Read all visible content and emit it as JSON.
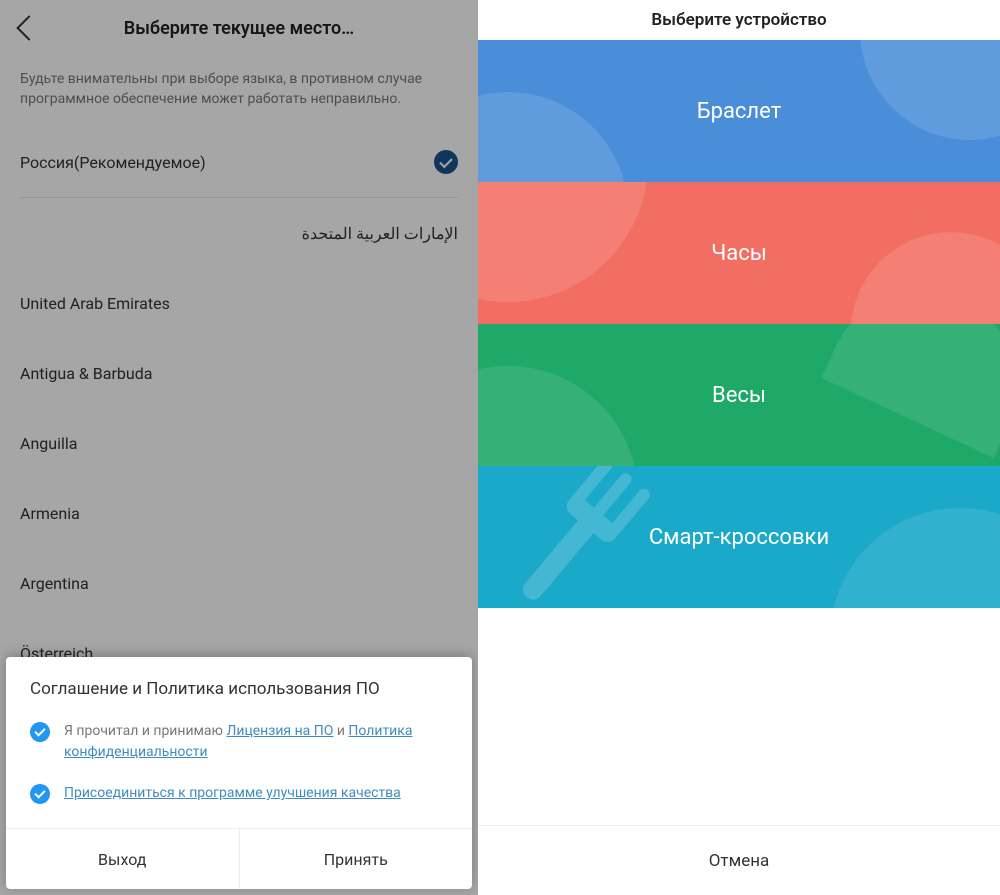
{
  "left": {
    "title": "Выберите текущее место…",
    "hint": "Будьте внимательны при выборе языка, в противном случае программное обеспечение может работать неправильно.",
    "countries": [
      {
        "label": "Россия(Рекомендуемое)",
        "selected": true
      },
      {
        "label": "الإمارات العربية المتحدة",
        "rtl": true
      },
      {
        "label": "United Arab Emirates"
      },
      {
        "label": "Antigua & Barbuda"
      },
      {
        "label": "Anguilla"
      },
      {
        "label": "Armenia"
      },
      {
        "label": "Argentina"
      },
      {
        "label": "Österreich"
      }
    ],
    "dialog": {
      "title": "Соглашение и Политика использования ПО",
      "row1_prefix": "Я прочитал и принимаю ",
      "row1_link1": "Лицензия на ПО",
      "row1_mid": " и ",
      "row1_link2": "Политика конфиденциальности",
      "row2_link": "Присоединиться к программе улучшения качества",
      "btn_exit": "Выход",
      "btn_accept": "Принять"
    }
  },
  "right": {
    "title": "Выберите устройство",
    "devices": [
      {
        "label": "Браслет",
        "color": "blue"
      },
      {
        "label": "Часы",
        "color": "red"
      },
      {
        "label": "Весы",
        "color": "green"
      },
      {
        "label": "Смарт-кроссовки",
        "color": "teal"
      }
    ],
    "cancel": "Отмена"
  }
}
